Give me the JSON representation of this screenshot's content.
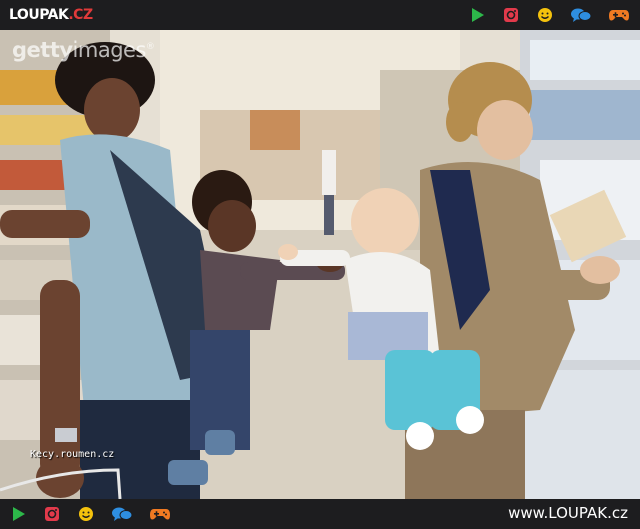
{
  "header": {
    "logo_main": "LOUPAK",
    "logo_suffix": ".CZ",
    "icons": [
      "play-icon",
      "instagram-icon",
      "smiley-icon",
      "chat-icon",
      "gamepad-icon"
    ]
  },
  "photo": {
    "watermark_bold": "getty",
    "watermark_light": "images",
    "watermark_mark": "®",
    "credit": "Kecy.roumen.cz"
  },
  "footer": {
    "icons": [
      "play-icon",
      "instagram-icon",
      "smiley-icon",
      "chat-icon",
      "gamepad-icon"
    ],
    "site": "www.LOUPAK.cz"
  },
  "colors": {
    "bar": "#1d1d1f",
    "play": "#2db84a",
    "instagram": "#e23a4b",
    "smiley": "#f4c20d",
    "chat": "#2e8ee0",
    "gamepad": "#f07a22"
  }
}
